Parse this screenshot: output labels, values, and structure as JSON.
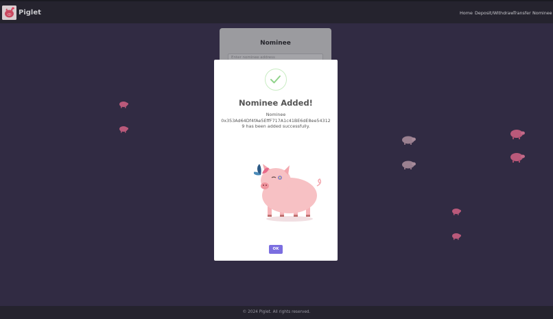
{
  "app": {
    "brand": "Piglet"
  },
  "nav": [
    {
      "label": "Home"
    },
    {
      "label": "Deposit/Withdraw"
    },
    {
      "label": "Transfer"
    },
    {
      "label": "Nominee"
    }
  ],
  "nominee_card": {
    "title": "Nominee",
    "input_placeholder": "Enter nominee address"
  },
  "modal": {
    "icon": "success-check-icon",
    "title": "Nominee Added!",
    "line1": "Nominee",
    "address": "0x353Ad64Df4fAe5EffF717A1c41BE6dE8ee54312",
    "line3": "9 has been added successfully.",
    "ok_label": "OK"
  },
  "footer": {
    "text": "© 2024 Piglet. All rights reserved."
  },
  "colors": {
    "background": "#312b43",
    "navbar": "#25232e",
    "accent": "#7b6ee0",
    "success": "#8fd38a",
    "pig": "#f7c1c4"
  }
}
